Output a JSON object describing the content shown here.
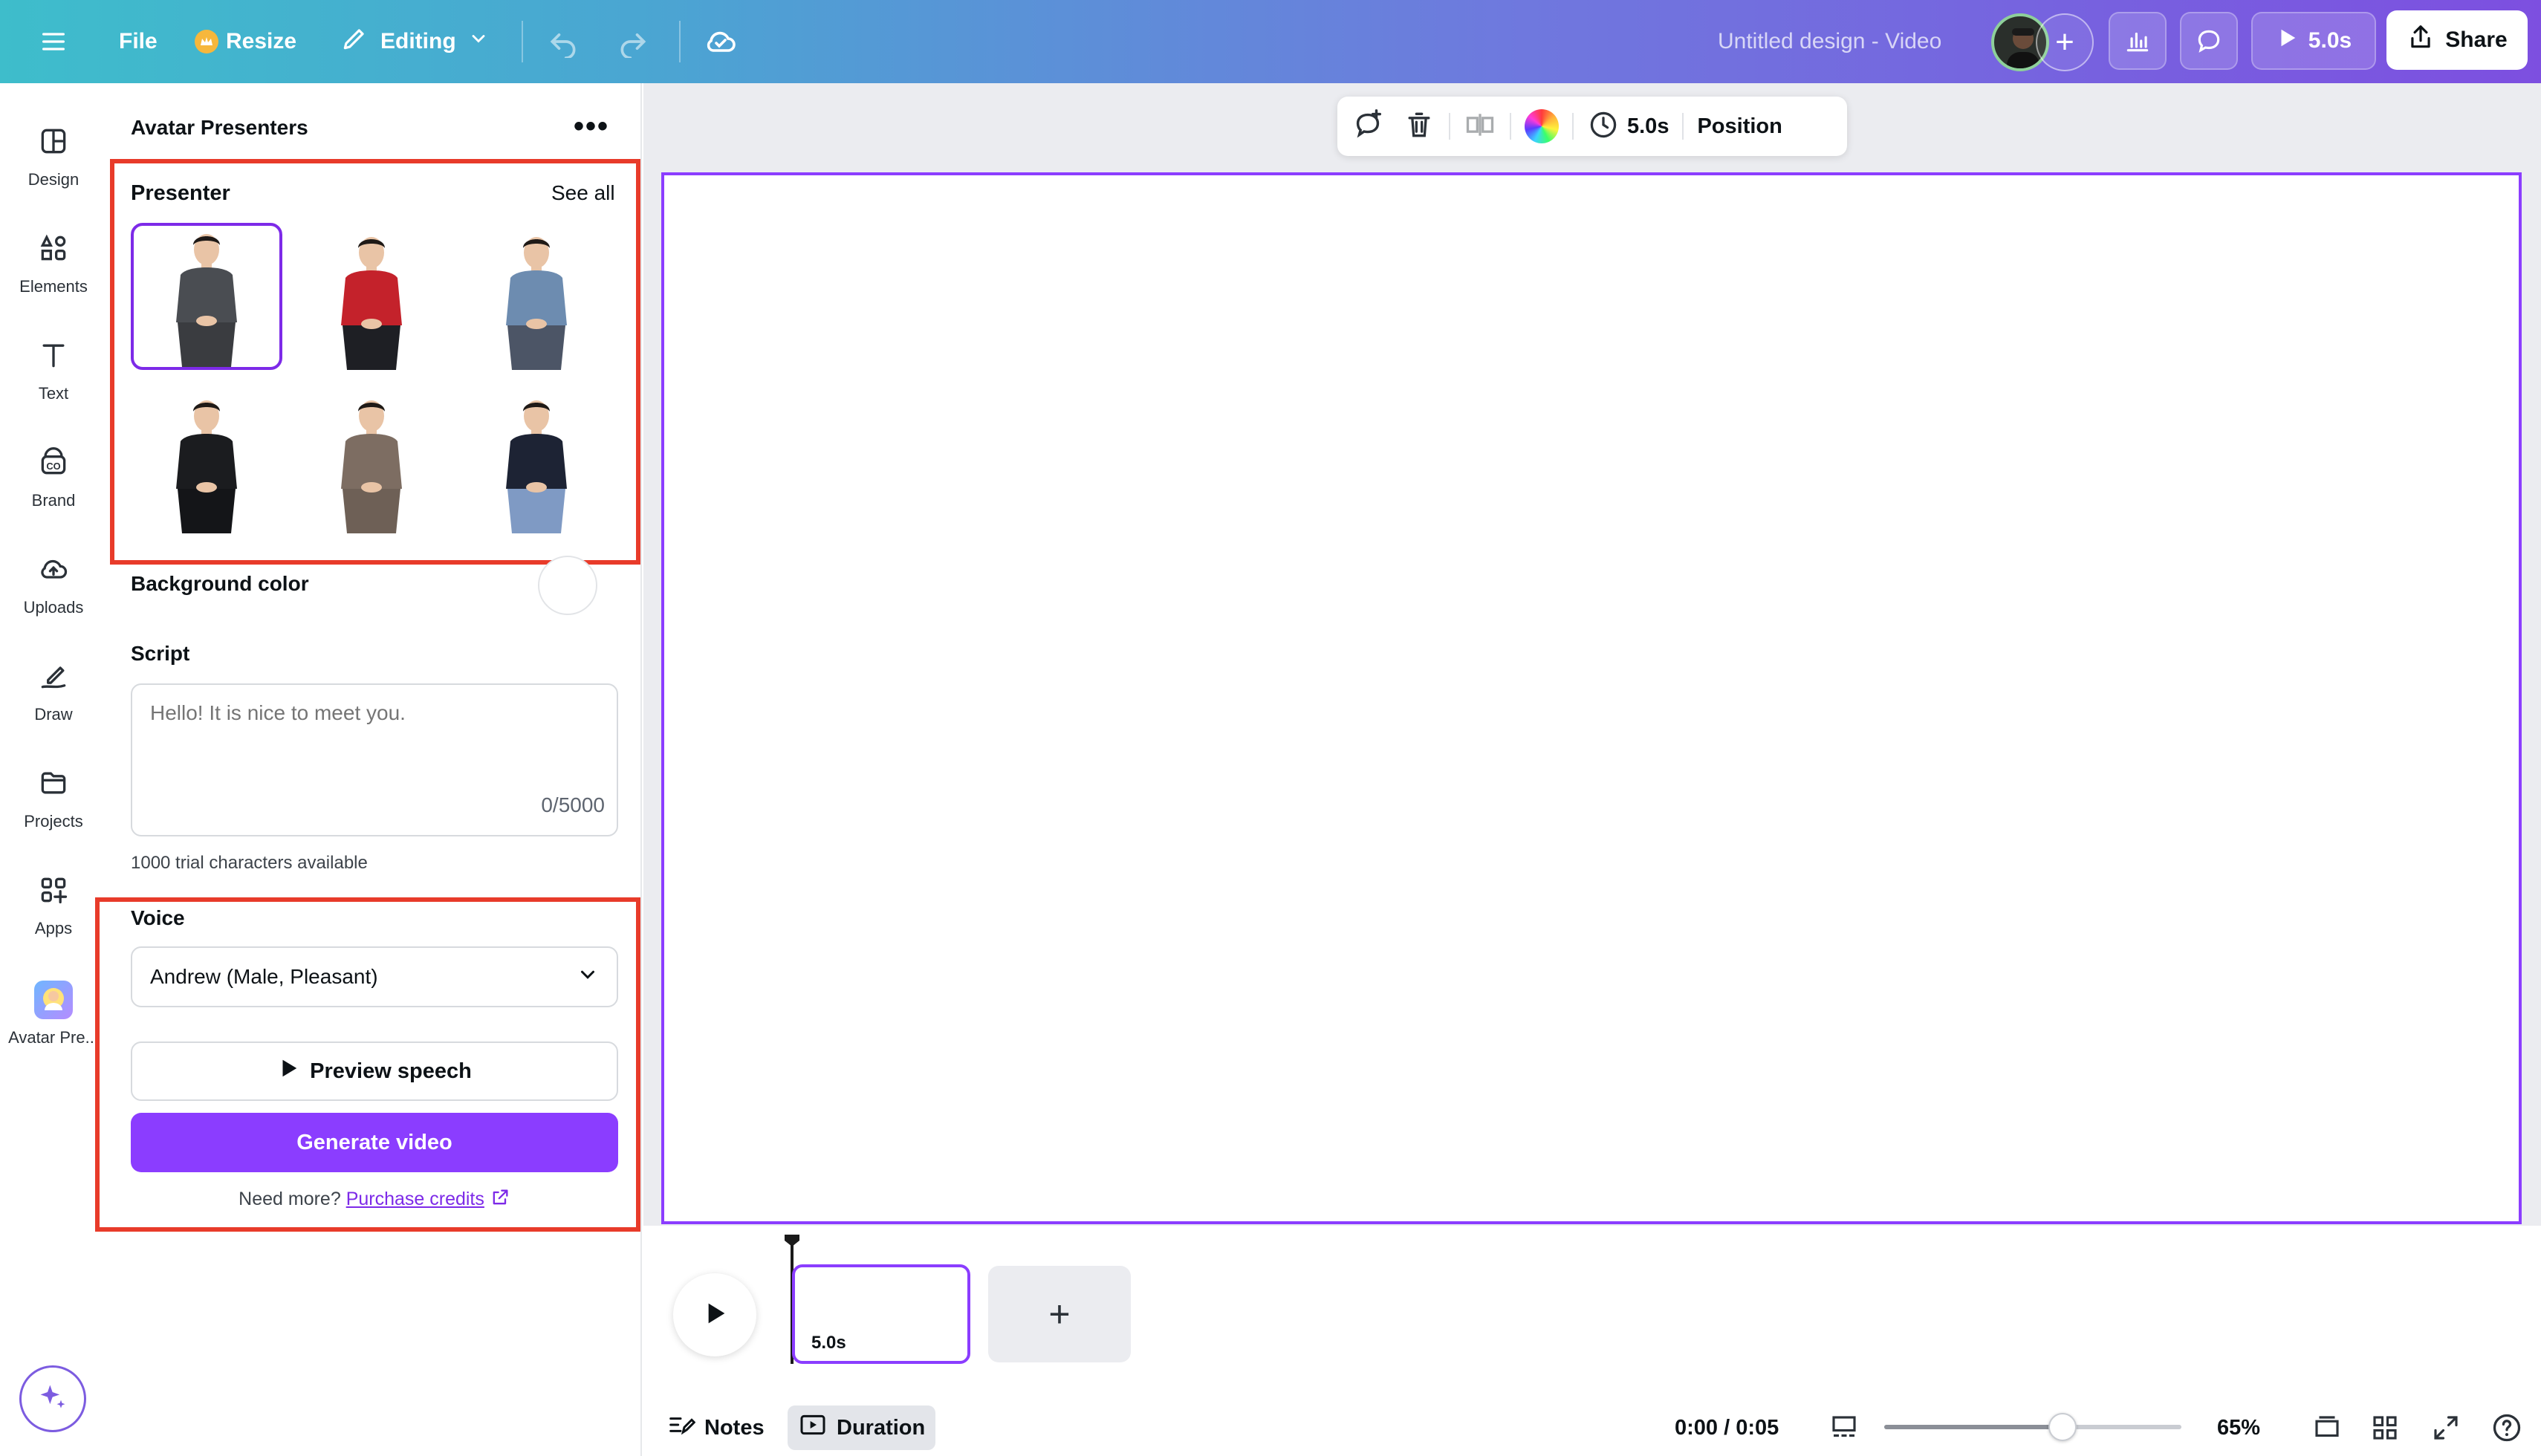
{
  "topbar": {
    "menu_icon": "hamburger-menu-icon",
    "file_label": "File",
    "resize_label": "Resize",
    "editing_label": "Editing",
    "doc_title": "Untitled design - Video",
    "play_duration": "5.0s",
    "share_label": "Share"
  },
  "rail": {
    "items": [
      {
        "label": "Design",
        "icon": "design-icon"
      },
      {
        "label": "Elements",
        "icon": "elements-icon"
      },
      {
        "label": "Text",
        "icon": "text-icon"
      },
      {
        "label": "Brand",
        "icon": "brand-icon"
      },
      {
        "label": "Uploads",
        "icon": "uploads-icon"
      },
      {
        "label": "Draw",
        "icon": "draw-icon"
      },
      {
        "label": "Projects",
        "icon": "projects-icon"
      },
      {
        "label": "Apps",
        "icon": "apps-icon"
      },
      {
        "label": "Avatar Pre...",
        "icon": "avatar-presenters-app-icon"
      }
    ]
  },
  "panel": {
    "title": "Avatar Presenters",
    "presenter_heading": "Presenter",
    "see_all": "See all",
    "presenters": [
      {
        "name": "presenter-grey-blazer",
        "outfit": "#4a4d52",
        "pants": "#3a3c40"
      },
      {
        "name": "presenter-red-sweater",
        "outfit": "#c4222b",
        "pants": "#1e1f24"
      },
      {
        "name": "presenter-denim-shirt",
        "outfit": "#6d8cb0",
        "pants": "#4c5566"
      },
      {
        "name": "presenter-black-suit",
        "outfit": "#1b1c1f",
        "pants": "#141518"
      },
      {
        "name": "presenter-brown-suit",
        "outfit": "#7d6d62",
        "pants": "#6e6056"
      },
      {
        "name": "presenter-navy-tshirt",
        "outfit": "#1d2334",
        "pants": "#7f9ac4"
      }
    ],
    "background_color_label": "Background color",
    "script_label": "Script",
    "script_placeholder": "Hello! It is nice to meet you.",
    "char_count": "0/5000",
    "trial_note": "1000 trial characters available",
    "voice_label": "Voice",
    "voice_selected": "Andrew (Male, Pleasant)",
    "preview_speech": "Preview speech",
    "generate_video": "Generate video",
    "need_more": "Need more?",
    "purchase_credits": "Purchase credits"
  },
  "toolbar": {
    "duration": "5.0s",
    "position": "Position"
  },
  "timeline": {
    "scene_duration": "5.0s",
    "notes_label": "Notes",
    "duration_label": "Duration",
    "time_readout": "0:00 / 0:05",
    "zoom": "65%",
    "zoom_fraction": 0.6
  },
  "colors": {
    "accent": "#8b3dff",
    "highlight_box": "#e83b2a"
  }
}
